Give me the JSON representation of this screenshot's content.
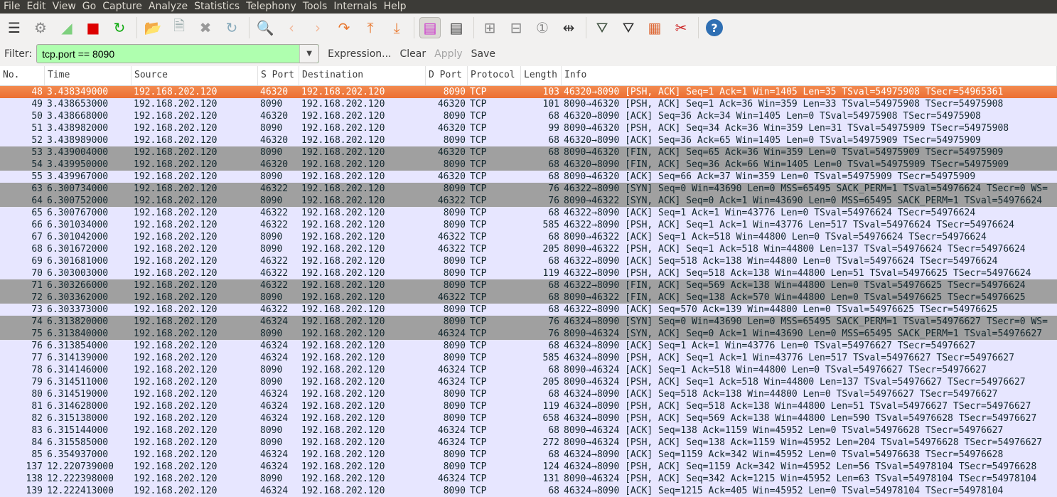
{
  "menu": [
    "File",
    "Edit",
    "View",
    "Go",
    "Capture",
    "Analyze",
    "Statistics",
    "Telephony",
    "Tools",
    "Internals",
    "Help"
  ],
  "toolbar": [
    {
      "icon": "interface-list-icon",
      "glyph": "☰",
      "color": "#333"
    },
    {
      "icon": "capture-options-icon",
      "glyph": "⚙",
      "color": "#888"
    },
    {
      "icon": "start-capture-icon",
      "glyph": "◢",
      "color": "#7ed07e"
    },
    {
      "icon": "stop-capture-icon",
      "glyph": "■",
      "color": "#d00"
    },
    {
      "icon": "restart-capture-icon",
      "glyph": "↻",
      "color": "#1a1"
    },
    {
      "sep": true
    },
    {
      "icon": "open-file-icon",
      "glyph": "📂",
      "color": "#e9a07a"
    },
    {
      "icon": "save-file-icon",
      "glyph": "🗎",
      "color": "#9aa"
    },
    {
      "icon": "close-file-icon",
      "glyph": "✖",
      "color": "#999"
    },
    {
      "icon": "reload-icon",
      "glyph": "↻",
      "color": "#8ab"
    },
    {
      "sep": true
    },
    {
      "icon": "find-packet-icon",
      "glyph": "🔍",
      "color": "#235"
    },
    {
      "icon": "go-back-icon",
      "glyph": "‹",
      "color": "#f2b89a"
    },
    {
      "icon": "go-forward-icon",
      "glyph": "›",
      "color": "#f2b89a"
    },
    {
      "icon": "go-to-packet-icon",
      "glyph": "↷",
      "color": "#e8762c"
    },
    {
      "icon": "go-first-icon",
      "glyph": "⤒",
      "color": "#e8762c"
    },
    {
      "icon": "go-last-icon",
      "glyph": "⤓",
      "color": "#e8762c"
    },
    {
      "sep": true
    },
    {
      "icon": "colorize-icon",
      "glyph": "▤",
      "color": "#c3c",
      "pressed": true
    },
    {
      "icon": "auto-scroll-icon",
      "glyph": "▤",
      "color": "#333"
    },
    {
      "sep": true
    },
    {
      "icon": "zoom-in-icon",
      "glyph": "⊞",
      "color": "#888"
    },
    {
      "icon": "zoom-out-icon",
      "glyph": "⊟",
      "color": "#888"
    },
    {
      "icon": "normal-size-icon",
      "glyph": "①",
      "color": "#888"
    },
    {
      "icon": "resize-columns-icon",
      "glyph": "⇹",
      "color": "#333"
    },
    {
      "sep": true
    },
    {
      "icon": "capture-filters-icon",
      "glyph": "⛛",
      "color": "#454"
    },
    {
      "icon": "display-filters-icon",
      "glyph": "⛛",
      "color": "#333"
    },
    {
      "icon": "coloring-rules-icon",
      "glyph": "▦",
      "color": "#d63"
    },
    {
      "icon": "preferences-icon",
      "glyph": "✂",
      "color": "#c22"
    },
    {
      "sep": true
    },
    {
      "icon": "help-icon",
      "glyph": "?",
      "color": "#fff",
      "bg": "#2f6fb3"
    }
  ],
  "filter": {
    "label": "Filter:",
    "value": "tcp.port == 8090",
    "expression": "Expression...",
    "clear": "Clear",
    "apply": "Apply",
    "save": "Save"
  },
  "columns": [
    "No.",
    "Time",
    "Source",
    "S Port",
    "Destination",
    "D Port",
    "Protocol",
    "Length",
    "Info"
  ],
  "colors": {
    "normal": "#e7e6ff",
    "gray": "#a0a0a0",
    "selected": "#ec6f33"
  },
  "packets": [
    {
      "s": "sel",
      "v": [
        "48",
        "3.438349000",
        "192.168.202.120",
        "46320",
        "192.168.202.120",
        "8090",
        "TCP",
        "103",
        "46320→8090 [PSH, ACK] Seq=1 Ack=1 Win=1405 Len=35 TSval=54975908 TSecr=54965361"
      ]
    },
    {
      "s": "",
      "v": [
        "49",
        "3.438653000",
        "192.168.202.120",
        "8090",
        "192.168.202.120",
        "46320",
        "TCP",
        "101",
        "8090→46320 [PSH, ACK] Seq=1 Ack=36 Win=359 Len=33 TSval=54975908 TSecr=54975908"
      ]
    },
    {
      "s": "",
      "v": [
        "50",
        "3.438668000",
        "192.168.202.120",
        "46320",
        "192.168.202.120",
        "8090",
        "TCP",
        "68",
        "46320→8090 [ACK] Seq=36 Ack=34 Win=1405 Len=0 TSval=54975908 TSecr=54975908"
      ]
    },
    {
      "s": "",
      "v": [
        "51",
        "3.438982000",
        "192.168.202.120",
        "8090",
        "192.168.202.120",
        "46320",
        "TCP",
        "99",
        "8090→46320 [PSH, ACK] Seq=34 Ack=36 Win=359 Len=31 TSval=54975909 TSecr=54975908"
      ]
    },
    {
      "s": "",
      "v": [
        "52",
        "3.438989000",
        "192.168.202.120",
        "46320",
        "192.168.202.120",
        "8090",
        "TCP",
        "68",
        "46320→8090 [ACK] Seq=36 Ack=65 Win=1405 Len=0 TSval=54975909 TSecr=54975909"
      ]
    },
    {
      "s": "gray",
      "v": [
        "53",
        "3.439004000",
        "192.168.202.120",
        "8090",
        "192.168.202.120",
        "46320",
        "TCP",
        "68",
        "8090→46320 [FIN, ACK] Seq=65 Ack=36 Win=359 Len=0 TSval=54975909 TSecr=54975909"
      ]
    },
    {
      "s": "gray",
      "v": [
        "54",
        "3.439950000",
        "192.168.202.120",
        "46320",
        "192.168.202.120",
        "8090",
        "TCP",
        "68",
        "46320→8090 [FIN, ACK] Seq=36 Ack=66 Win=1405 Len=0 TSval=54975909 TSecr=54975909"
      ]
    },
    {
      "s": "",
      "v": [
        "55",
        "3.439967000",
        "192.168.202.120",
        "8090",
        "192.168.202.120",
        "46320",
        "TCP",
        "68",
        "8090→46320 [ACK] Seq=66 Ack=37 Win=359 Len=0 TSval=54975909 TSecr=54975909"
      ]
    },
    {
      "s": "gray",
      "v": [
        "63",
        "6.300734000",
        "192.168.202.120",
        "46322",
        "192.168.202.120",
        "8090",
        "TCP",
        "76",
        "46322→8090 [SYN] Seq=0 Win=43690 Len=0 MSS=65495 SACK_PERM=1 TSval=54976624 TSecr=0 WS="
      ]
    },
    {
      "s": "gray",
      "v": [
        "64",
        "6.300752000",
        "192.168.202.120",
        "8090",
        "192.168.202.120",
        "46322",
        "TCP",
        "76",
        "8090→46322 [SYN, ACK] Seq=0 Ack=1 Win=43690 Len=0 MSS=65495 SACK_PERM=1 TSval=54976624"
      ]
    },
    {
      "s": "",
      "v": [
        "65",
        "6.300767000",
        "192.168.202.120",
        "46322",
        "192.168.202.120",
        "8090",
        "TCP",
        "68",
        "46322→8090 [ACK] Seq=1 Ack=1 Win=43776 Len=0 TSval=54976624 TSecr=54976624"
      ]
    },
    {
      "s": "",
      "v": [
        "66",
        "6.301034000",
        "192.168.202.120",
        "46322",
        "192.168.202.120",
        "8090",
        "TCP",
        "585",
        "46322→8090 [PSH, ACK] Seq=1 Ack=1 Win=43776 Len=517 TSval=54976624 TSecr=54976624"
      ]
    },
    {
      "s": "",
      "v": [
        "67",
        "6.301042000",
        "192.168.202.120",
        "8090",
        "192.168.202.120",
        "46322",
        "TCP",
        "68",
        "8090→46322 [ACK] Seq=1 Ack=518 Win=44800 Len=0 TSval=54976624 TSecr=54976624"
      ]
    },
    {
      "s": "",
      "v": [
        "68",
        "6.301672000",
        "192.168.202.120",
        "8090",
        "192.168.202.120",
        "46322",
        "TCP",
        "205",
        "8090→46322 [PSH, ACK] Seq=1 Ack=518 Win=44800 Len=137 TSval=54976624 TSecr=54976624"
      ]
    },
    {
      "s": "",
      "v": [
        "69",
        "6.301681000",
        "192.168.202.120",
        "46322",
        "192.168.202.120",
        "8090",
        "TCP",
        "68",
        "46322→8090 [ACK] Seq=518 Ack=138 Win=44800 Len=0 TSval=54976624 TSecr=54976624"
      ]
    },
    {
      "s": "",
      "v": [
        "70",
        "6.303003000",
        "192.168.202.120",
        "46322",
        "192.168.202.120",
        "8090",
        "TCP",
        "119",
        "46322→8090 [PSH, ACK] Seq=518 Ack=138 Win=44800 Len=51 TSval=54976625 TSecr=54976624"
      ]
    },
    {
      "s": "gray",
      "v": [
        "71",
        "6.303266000",
        "192.168.202.120",
        "46322",
        "192.168.202.120",
        "8090",
        "TCP",
        "68",
        "46322→8090 [FIN, ACK] Seq=569 Ack=138 Win=44800 Len=0 TSval=54976625 TSecr=54976624"
      ]
    },
    {
      "s": "gray",
      "v": [
        "72",
        "6.303362000",
        "192.168.202.120",
        "8090",
        "192.168.202.120",
        "46322",
        "TCP",
        "68",
        "8090→46322 [FIN, ACK] Seq=138 Ack=570 Win=44800 Len=0 TSval=54976625 TSecr=54976625"
      ]
    },
    {
      "s": "",
      "v": [
        "73",
        "6.303373000",
        "192.168.202.120",
        "46322",
        "192.168.202.120",
        "8090",
        "TCP",
        "68",
        "46322→8090 [ACK] Seq=570 Ack=139 Win=44800 Len=0 TSval=54976625 TSecr=54976625"
      ]
    },
    {
      "s": "gray",
      "v": [
        "74",
        "6.313820000",
        "192.168.202.120",
        "46324",
        "192.168.202.120",
        "8090",
        "TCP",
        "76",
        "46324→8090 [SYN] Seq=0 Win=43690 Len=0 MSS=65495 SACK_PERM=1 TSval=54976627 TSecr=0 WS="
      ]
    },
    {
      "s": "gray",
      "v": [
        "75",
        "6.313840000",
        "192.168.202.120",
        "8090",
        "192.168.202.120",
        "46324",
        "TCP",
        "76",
        "8090→46324 [SYN, ACK] Seq=0 Ack=1 Win=43690 Len=0 MSS=65495 SACK_PERM=1 TSval=54976627"
      ]
    },
    {
      "s": "",
      "v": [
        "76",
        "6.313854000",
        "192.168.202.120",
        "46324",
        "192.168.202.120",
        "8090",
        "TCP",
        "68",
        "46324→8090 [ACK] Seq=1 Ack=1 Win=43776 Len=0 TSval=54976627 TSecr=54976627"
      ]
    },
    {
      "s": "",
      "v": [
        "77",
        "6.314139000",
        "192.168.202.120",
        "46324",
        "192.168.202.120",
        "8090",
        "TCP",
        "585",
        "46324→8090 [PSH, ACK] Seq=1 Ack=1 Win=43776 Len=517 TSval=54976627 TSecr=54976627"
      ]
    },
    {
      "s": "",
      "v": [
        "78",
        "6.314146000",
        "192.168.202.120",
        "8090",
        "192.168.202.120",
        "46324",
        "TCP",
        "68",
        "8090→46324 [ACK] Seq=1 Ack=518 Win=44800 Len=0 TSval=54976627 TSecr=54976627"
      ]
    },
    {
      "s": "",
      "v": [
        "79",
        "6.314511000",
        "192.168.202.120",
        "8090",
        "192.168.202.120",
        "46324",
        "TCP",
        "205",
        "8090→46324 [PSH, ACK] Seq=1 Ack=518 Win=44800 Len=137 TSval=54976627 TSecr=54976627"
      ]
    },
    {
      "s": "",
      "v": [
        "80",
        "6.314519000",
        "192.168.202.120",
        "46324",
        "192.168.202.120",
        "8090",
        "TCP",
        "68",
        "46324→8090 [ACK] Seq=518 Ack=138 Win=44800 Len=0 TSval=54976627 TSecr=54976627"
      ]
    },
    {
      "s": "",
      "v": [
        "81",
        "6.314628000",
        "192.168.202.120",
        "46324",
        "192.168.202.120",
        "8090",
        "TCP",
        "119",
        "46324→8090 [PSH, ACK] Seq=518 Ack=138 Win=44800 Len=51 TSval=54976627 TSecr=54976627"
      ]
    },
    {
      "s": "",
      "v": [
        "82",
        "6.315138000",
        "192.168.202.120",
        "46324",
        "192.168.202.120",
        "8090",
        "TCP",
        "658",
        "46324→8090 [PSH, ACK] Seq=569 Ack=138 Win=44800 Len=590 TSval=54976628 TSecr=54976627"
      ]
    },
    {
      "s": "",
      "v": [
        "83",
        "6.315144000",
        "192.168.202.120",
        "8090",
        "192.168.202.120",
        "46324",
        "TCP",
        "68",
        "8090→46324 [ACK] Seq=138 Ack=1159 Win=45952 Len=0 TSval=54976628 TSecr=54976627"
      ]
    },
    {
      "s": "",
      "v": [
        "84",
        "6.315585000",
        "192.168.202.120",
        "8090",
        "192.168.202.120",
        "46324",
        "TCP",
        "272",
        "8090→46324 [PSH, ACK] Seq=138 Ack=1159 Win=45952 Len=204 TSval=54976628 TSecr=54976627"
      ]
    },
    {
      "s": "",
      "v": [
        "85",
        "6.354937000",
        "192.168.202.120",
        "46324",
        "192.168.202.120",
        "8090",
        "TCP",
        "68",
        "46324→8090 [ACK] Seq=1159 Ack=342 Win=45952 Len=0 TSval=54976638 TSecr=54976628"
      ]
    },
    {
      "s": "",
      "v": [
        "137",
        "12.220739000",
        "192.168.202.120",
        "46324",
        "192.168.202.120",
        "8090",
        "TCP",
        "124",
        "46324→8090 [PSH, ACK] Seq=1159 Ack=342 Win=45952 Len=56 TSval=54978104 TSecr=54976628"
      ]
    },
    {
      "s": "",
      "v": [
        "138",
        "12.222398000",
        "192.168.202.120",
        "8090",
        "192.168.202.120",
        "46324",
        "TCP",
        "131",
        "8090→46324 [PSH, ACK] Seq=342 Ack=1215 Win=45952 Len=63 TSval=54978104 TSecr=54978104"
      ]
    },
    {
      "s": "",
      "v": [
        "139",
        "12.222413000",
        "192.168.202.120",
        "46324",
        "192.168.202.120",
        "8090",
        "TCP",
        "68",
        "46324→8090 [ACK] Seq=1215 Ack=405 Win=45952 Len=0 TSval=54978104 TSecr=54978104"
      ]
    }
  ]
}
